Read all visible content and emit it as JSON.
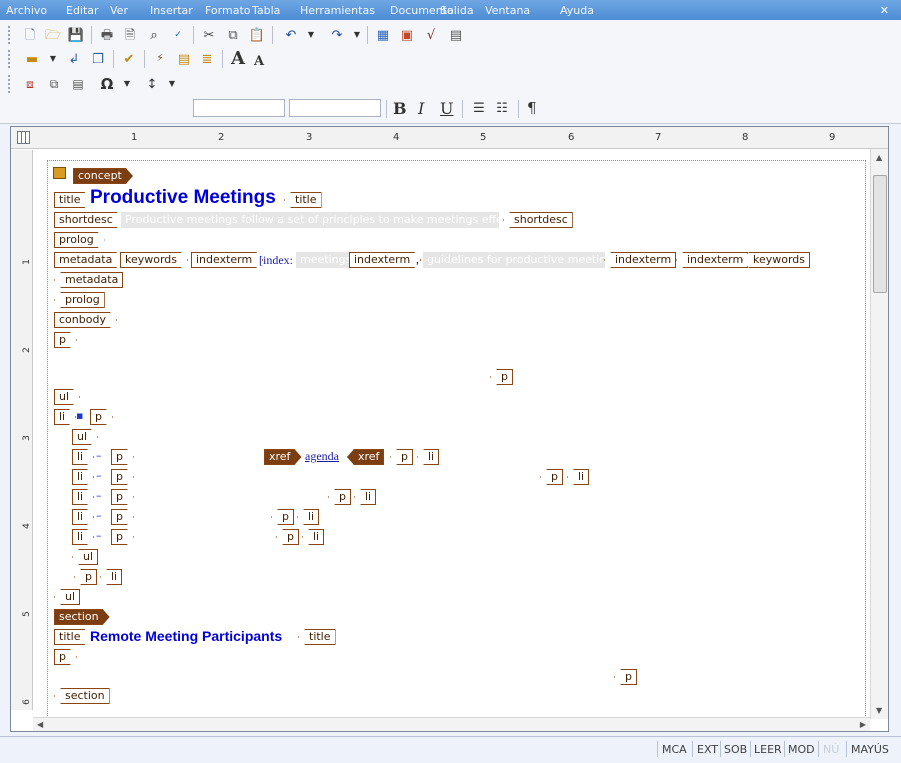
{
  "menu": [
    "Archivo",
    "Editar",
    "Ver",
    "Insertar",
    "Formato",
    "Tabla",
    "Herramientas",
    "Documento",
    "Salida",
    "Ventana",
    "Ayuda"
  ],
  "toolbar": {
    "row1": [
      "new-document-icon",
      "open-folder-icon",
      "save-icon",
      "print-icon",
      "print-preview-icon",
      "find-icon",
      "spell-check-icon",
      "cut-icon",
      "copy-icon",
      "paste-icon",
      "undo-icon",
      "redo-icon",
      "table-icon",
      "image-icon",
      "equation-icon",
      "form-icon"
    ],
    "grow_label": "A",
    "shrink_label": "A",
    "bold_label": "B",
    "italic_label": "I",
    "underline_label": "U",
    "paragraph_label": "¶"
  },
  "ruler": {
    "numbers": [
      "1",
      "2",
      "3",
      "4",
      "5",
      "6",
      "7",
      "8",
      "9"
    ],
    "vnumbers": [
      "1",
      "2",
      "3",
      "4",
      "5",
      "6"
    ]
  },
  "doc": {
    "concept_tag": "concept",
    "title_tag": "title",
    "title_text": "Productive Meetings",
    "shortdesc_tag": "shortdesc",
    "shortdesc_text": "Productive meetings follow a set of principles to make meetings effective and",
    "prolog_tag": "prolog",
    "metadata_tag": "metadata",
    "keywords_tag": "keywords",
    "indexterm_tag": "indexterm",
    "index_label": "[index:",
    "index_text1": "meetings",
    "index_comma": ",",
    "index_text2": "guidelines for productive meetings",
    "conbody_tag": "conbody",
    "p_tag": "p",
    "ul_tag": "ul",
    "li_tag": "li",
    "xref_tag": "xref",
    "xref_text": "agenda",
    "section_tag": "section",
    "section_title": "Remote Meeting Participants"
  },
  "status": [
    "MCA",
    "EXT",
    "SOB",
    "LEER",
    "MOD",
    "NÚ",
    "MAYÚS"
  ]
}
